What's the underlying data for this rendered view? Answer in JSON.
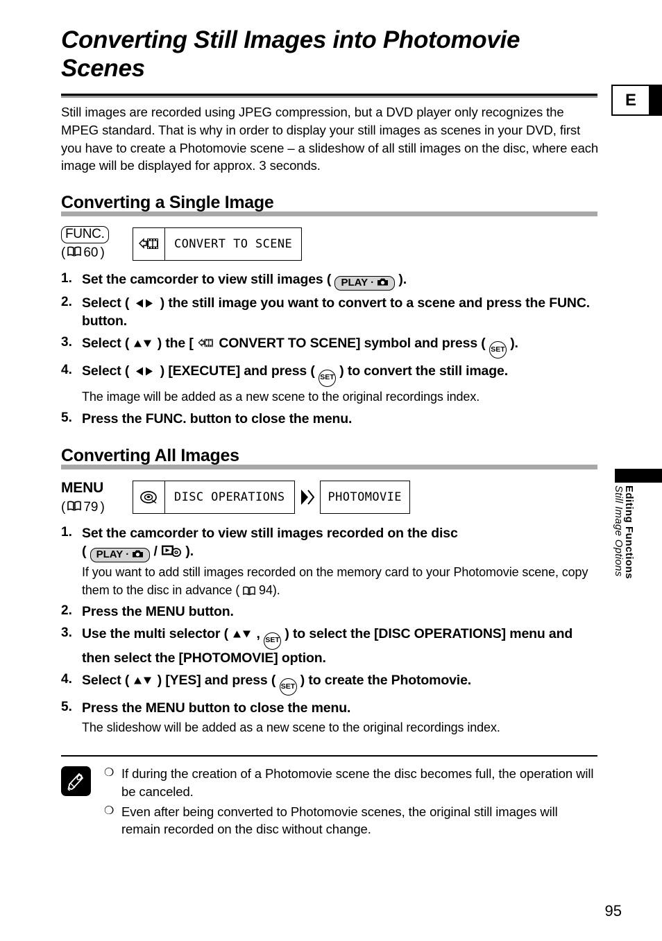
{
  "page": {
    "number": "95",
    "tab_letter": "E",
    "sidebar_chapter": "Editing Functions",
    "sidebar_subchapter": "Still Image Options"
  },
  "title": "Converting Still Images into Photomovie Scenes",
  "intro": "Still images are recorded using JPEG compression, but a DVD player only recognizes the MPEG standard. That is why in order to display your still images as scenes in your DVD, first you have to create a Photomovie scene – a slideshow of all still images on the disc, where each image will be displayed for approx. 3 seconds.",
  "sections": [
    {
      "heading": "Converting a Single Image",
      "path": {
        "label": "FUNC.",
        "label_kind": "func-pill",
        "pageref": "60",
        "boxes": [
          {
            "icon": "convert-to-scene-icon",
            "text": "CONVERT TO SCENE"
          }
        ]
      },
      "steps": [
        {
          "num": "1.",
          "main_pre": "Set the camcorder to view still images ( ",
          "glyph": "play-still-button",
          "main_post": " ).",
          "sub": ""
        },
        {
          "num": "2.",
          "main_pre": "Select ( ",
          "glyph": "left-right-arrows",
          "main_post": " ) the still image you want to convert to a scene and press the FUNC. button.",
          "sub": ""
        },
        {
          "num": "3.",
          "main_pre": "Select ( ",
          "glyph": "up-down-arrows",
          "main_mid": " ) the [",
          "inline_icon": "convert-to-scene-icon",
          "main_mid2": " CONVERT TO SCENE] symbol and press ( ",
          "glyph2": "set-button",
          "main_post": " ).",
          "sub": ""
        },
        {
          "num": "4.",
          "main_pre": "Select ( ",
          "glyph": "left-right-arrows",
          "main_mid2": " ) [EXECUTE] and press ( ",
          "glyph2": "set-button",
          "main_post": " ) to convert the still image.",
          "sub": "The image will be added as a new scene to the original recordings index."
        },
        {
          "num": "5.",
          "main_pre": "Press the FUNC. button to close the menu.",
          "sub": ""
        }
      ]
    },
    {
      "heading": "Converting All Images",
      "path": {
        "label": "MENU",
        "label_kind": "menu-word",
        "pageref": "79",
        "boxes": [
          {
            "icon": "disc-icon",
            "text": "DISC OPERATIONS"
          },
          {
            "icon": "",
            "text": "PHOTOMOVIE"
          }
        ]
      },
      "steps": [
        {
          "num": "1.",
          "main_pre": "Set the camcorder to view still images recorded on the disc",
          "main_line2_pre": "( ",
          "glyph": "play-still-button",
          "main_line2_mid": " / ",
          "glyph2": "card-play-icon",
          "main_line2_post": " ).",
          "sub": "If you want to add still images recorded on the memory card to your Photomovie scene, copy them to the disc in advance (",
          "sub_pageref": "94",
          "sub_post": ")."
        },
        {
          "num": "2.",
          "main_pre": "Press the MENU button.",
          "sub": ""
        },
        {
          "num": "3.",
          "main_pre": "Use the multi selector ( ",
          "glyph": "up-down-arrows",
          "main_mid": " , ",
          "glyph2": "set-button",
          "main_post": " ) to select the [DISC OPERATIONS] menu and then select the [PHOTOMOVIE] option.",
          "sub": ""
        },
        {
          "num": "4.",
          "main_pre": "Select ( ",
          "glyph": "up-down-arrows",
          "main_mid2": " ) [YES] and press ( ",
          "glyph2": "set-button",
          "main_post": " ) to create the Photomovie.",
          "sub": ""
        },
        {
          "num": "5.",
          "main_pre": "Press the MENU button to close the menu.",
          "sub": "The slideshow will be added as a new scene to the original recordings index."
        }
      ]
    }
  ],
  "notes": {
    "icon": "memo-pencil-icon",
    "items": [
      "If during the creation of a Photomovie scene the disc becomes full, the operation will be canceled.",
      "Even after being converted to Photomovie scenes, the original still images will remain recorded on the disc without change."
    ]
  },
  "glyph_labels": {
    "play_label": "PLAY",
    "play_dot": "·",
    "set_label": "SET",
    "bullet": "❍"
  },
  "colors": {
    "rule_dark": "#000000",
    "rule_gray": "#a8a8a8",
    "pill_fill": "#d4d4d4"
  }
}
